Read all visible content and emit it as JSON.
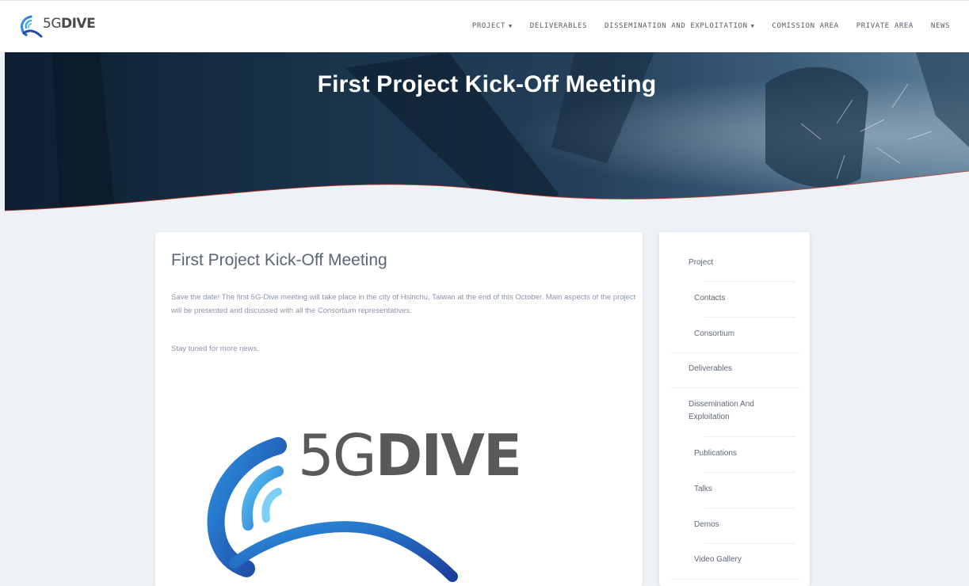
{
  "brand": {
    "logo_text_thin": "5G",
    "logo_text_bold": "DIVE"
  },
  "nav": {
    "items": [
      {
        "label": "PROJECT",
        "caret": "▼"
      },
      {
        "label": "DELIVERABLES",
        "caret": ""
      },
      {
        "label": "DISSEMINATION AND EXPLOITATION",
        "caret": "▼"
      },
      {
        "label": "COMISSION AREA",
        "caret": ""
      },
      {
        "label": "PRIVATE AREA",
        "caret": ""
      },
      {
        "label": "NEWS",
        "caret": ""
      }
    ]
  },
  "hero": {
    "title": "First Project Kick-Off Meeting"
  },
  "article": {
    "title": "First Project Kick-Off Meeting",
    "paragraph1": "Save the date! The first 5G-Dive meeting will take place in the city of Hsinchu, Taiwan at the end of this October. Main aspects of the project will be presented and discussed with all the Consortium representatives.",
    "paragraph2": "Stay tuned for more news.",
    "image_logo_thin": "5G",
    "image_logo_bold": "DIVE"
  },
  "sidebar": {
    "items": [
      {
        "label": "Project"
      },
      {
        "label": "Contacts"
      },
      {
        "label": "Consortium"
      },
      {
        "label": "Deliverables"
      },
      {
        "label": "Dissemination And Exploitation"
      },
      {
        "label": "Publications"
      },
      {
        "label": "Talks"
      },
      {
        "label": "Demos"
      },
      {
        "label": "Video Gallery"
      }
    ]
  },
  "colors": {
    "page_bg": "#eef2f7",
    "hero_dark": "#0f2438",
    "hero_mid": "#2a4a66",
    "accent_red": "#c0392b",
    "logo_blue": "#1e5bb5",
    "logo_light_blue": "#3ea8e8",
    "logo_gray": "#555555"
  },
  "icons": {
    "nav_dropdown": "caret-down-icon",
    "brand_mark": "wave-logo-icon"
  }
}
